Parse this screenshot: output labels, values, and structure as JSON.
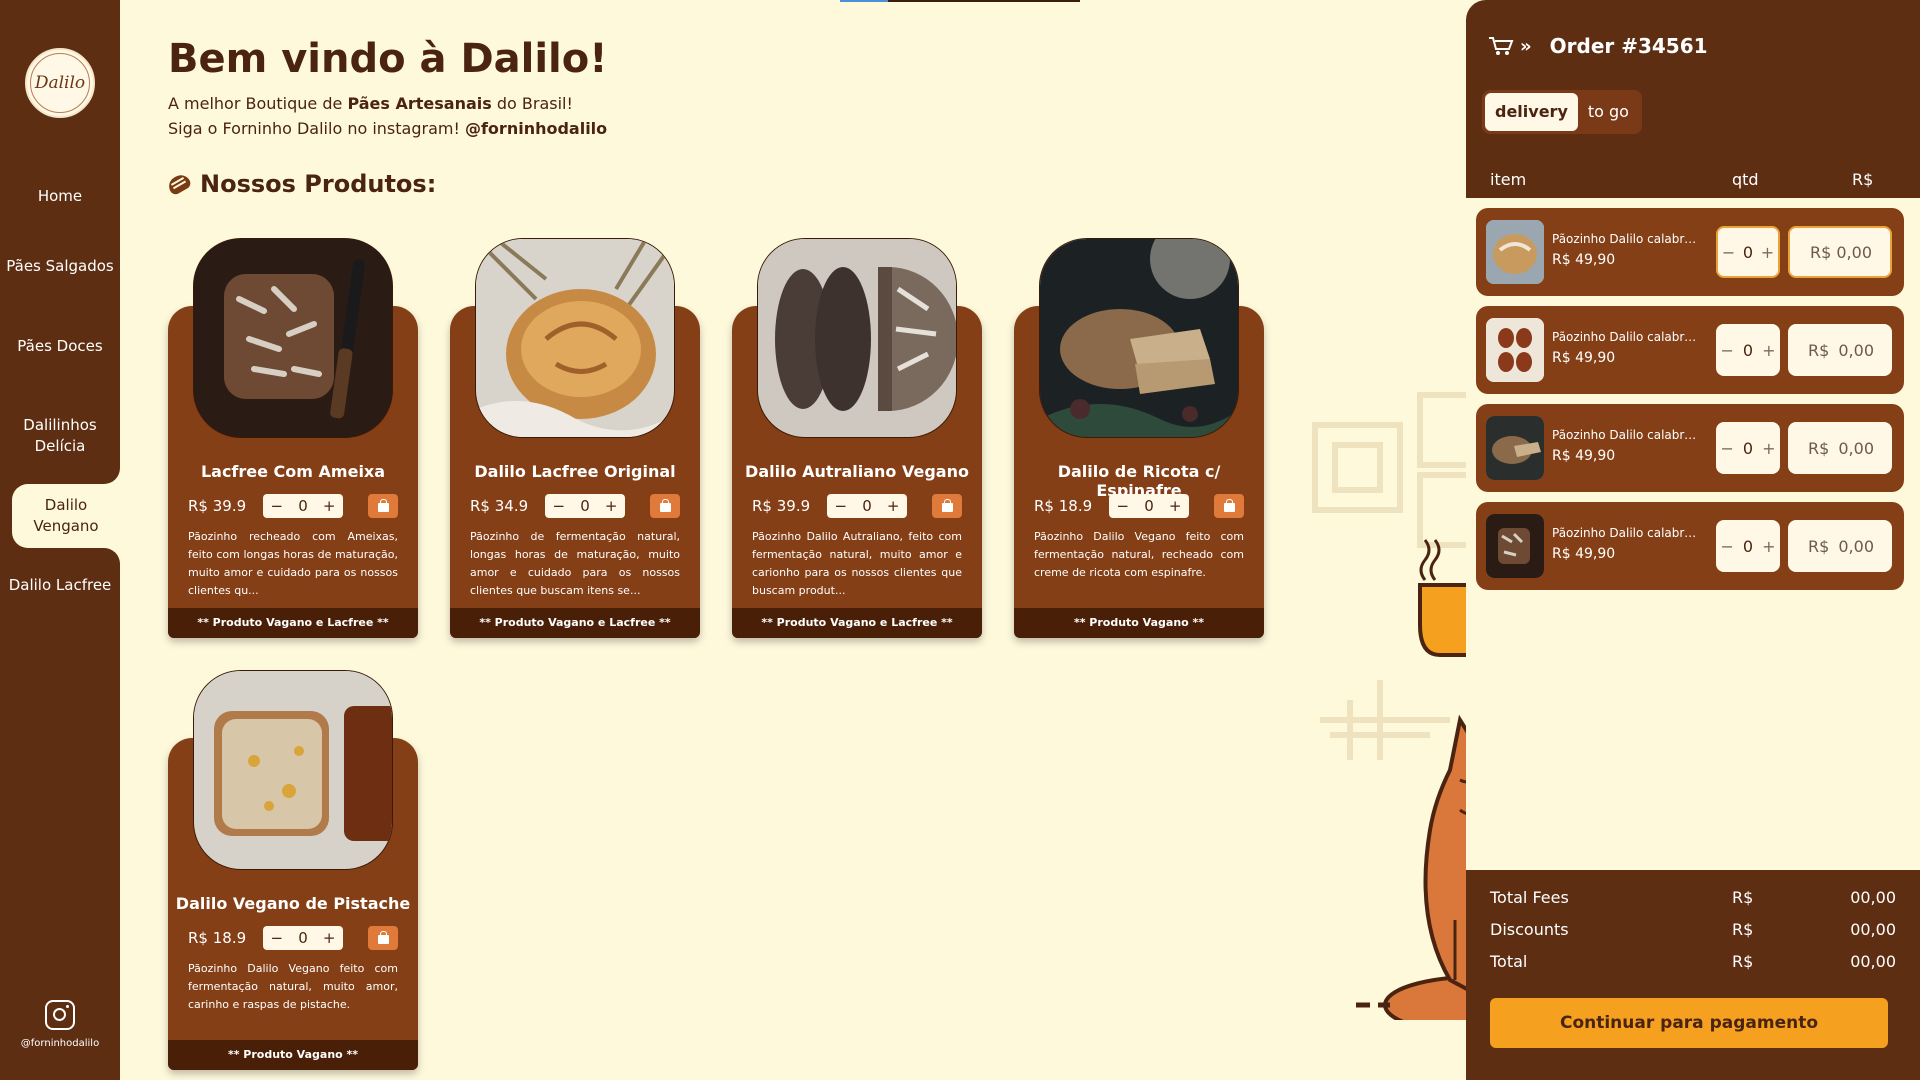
{
  "brand": {
    "logo_text": "Dalilo"
  },
  "sidebar": {
    "items": [
      {
        "label": "Home"
      },
      {
        "label": "Pães Salgados"
      },
      {
        "label": "Pães Doces"
      },
      {
        "label": "Dalilinhos Delícia"
      },
      {
        "label": "Dalilo Vengano"
      },
      {
        "label": "Dalilo Lacfree"
      }
    ],
    "active_index": 4,
    "instagram_handle": "@forninhodalilo"
  },
  "header": {
    "title": "Bem vindo à Dalilo!",
    "line1_prefix": "A melhor Boutique de ",
    "line1_bold": "Pães Artesanais",
    "line1_suffix": " do Brasil!",
    "line2_prefix": "Siga o Forninho Dalilo no instagram! ",
    "line2_bold": "@forninhodalilo"
  },
  "section_title": "Nossos Produtos:",
  "products": [
    {
      "name": "Lacfree Com Ameixa",
      "price": "R$ 39.9",
      "qty": "0",
      "description": "Pãozinho recheado com Ameixas, feito com longas horas de maturação, muito amor e cuidado para os nossos clientes qu...",
      "tag": "**  Produto Vagano e Lacfree  **",
      "photo": "dark-rye-loaf-with-knife"
    },
    {
      "name": "Dalilo Lacfree Original",
      "price": "R$ 34.9",
      "qty": "0",
      "description": "Pãozinho de fermentação natural, longas horas de maturação, muito amor e cuidado para os nossos clientes que buscam itens se...",
      "tag": "**  Produto Vagano e Lacfree  **",
      "photo": "golden-round-loaf-in-cloth"
    },
    {
      "name": "Dalilo Autraliano Vegano",
      "price": "R$ 39.9",
      "qty": "0",
      "description": "Pãozinho Dalilo Autraliano, feito com fermentação natural, muito amor e carionho para os nossos clientes que buscam produt...",
      "tag": "**  Produto Vagano e Lacfree  **",
      "photo": "sliced-dark-seeded-bread"
    },
    {
      "name": "Dalilo de Ricota c/ Espinafre",
      "price": "R$ 18.9",
      "qty": "0",
      "description": "Pãozinho Dalilo Vegano feito com fermentação natural, recheado com creme de ricota com espinafre.",
      "tag": "**  Produto Vagano  **",
      "photo": "sliced-loaf-dark-background"
    },
    {
      "name": "Dalilo Vegano de Pistache",
      "price": "R$ 18.9",
      "qty": "0",
      "description": "Pãozinho Dalilo Vegano feito com fermentação natural, muito amor, carinho e raspas de pistache.",
      "tag": "**  Produto Vagano  **",
      "photo": "sliced-pistachio-bread"
    }
  ],
  "cart": {
    "title": "Order #34561",
    "toggle": {
      "delivery": "delivery",
      "to_go": "to go",
      "selected": "delivery"
    },
    "columns": {
      "item": "item",
      "qtd": "qtd",
      "currency": "R$"
    },
    "items": [
      {
        "name": "Pãozinho Dalilo calabresa",
        "price": "R$ 49,90",
        "qty": "0",
        "currency": "R$",
        "total": "0,00"
      },
      {
        "name": "Pãozinho Dalilo calabresa",
        "price": "R$ 49,90",
        "qty": "0",
        "currency": "R$",
        "total": "0,00"
      },
      {
        "name": "Pãozinho Dalilo calabresa",
        "price": "R$ 49,90",
        "qty": "0",
        "currency": "R$",
        "total": "0,00"
      },
      {
        "name": "Pãozinho Dalilo calabresa",
        "price": "R$ 49,90",
        "qty": "0",
        "currency": "R$",
        "total": "0,00"
      }
    ],
    "totals": [
      {
        "label": "Total Fees",
        "currency": "R$",
        "value": "00,00"
      },
      {
        "label": "Discounts",
        "currency": "R$",
        "value": "00,00"
      },
      {
        "label": "Total",
        "currency": "R$",
        "value": "00,00"
      }
    ],
    "pay_button": "Continuar para pagamento"
  },
  "colors": {
    "background": "#fff9dc",
    "sidebar": "#5e2e13",
    "card": "#843f16",
    "accent": "#f5a01f",
    "bag_button": "#e07a3a"
  }
}
